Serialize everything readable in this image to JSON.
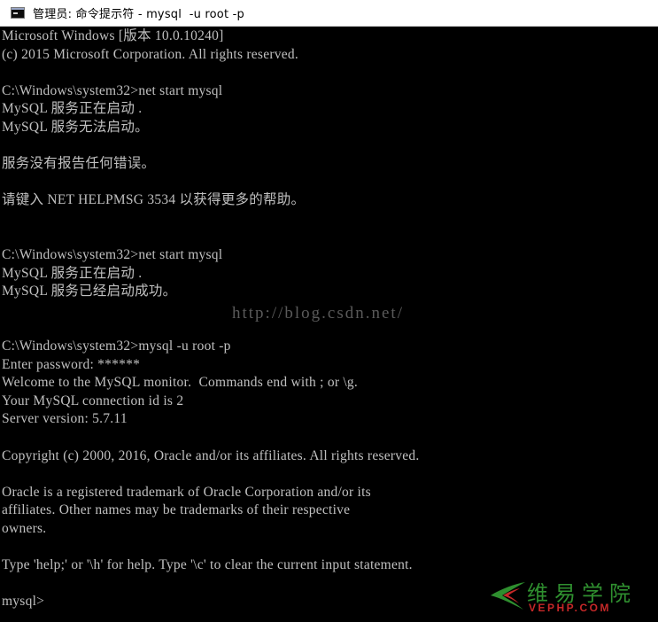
{
  "window": {
    "title": "管理员: 命令提示符 - mysql  -u root -p"
  },
  "console": {
    "lines": [
      "Microsoft Windows [版本 10.0.10240]",
      "(c) 2015 Microsoft Corporation. All rights reserved.",
      "",
      "C:\\Windows\\system32>net start mysql",
      "MySQL 服务正在启动 .",
      "MySQL 服务无法启动。",
      "",
      "服务没有报告任何错误。",
      "",
      "请键入 NET HELPMSG 3534 以获得更多的帮助。",
      "",
      "",
      "C:\\Windows\\system32>net start mysql",
      "MySQL 服务正在启动 .",
      "MySQL 服务已经启动成功。",
      "",
      "",
      "C:\\Windows\\system32>mysql -u root -p",
      "Enter password: ******",
      "Welcome to the MySQL monitor.  Commands end with ; or \\g.",
      "Your MySQL connection id is 2",
      "Server version: 5.7.11",
      "",
      "Copyright (c) 2000, 2016, Oracle and/or its affiliates. All rights reserved.",
      "",
      "Oracle is a registered trademark of Oracle Corporation and/or its",
      "affiliates. Other names may be trademarks of their respective",
      "owners.",
      "",
      "Type 'help;' or '\\h' for help. Type '\\c' to clear the current input statement.",
      "",
      "mysql>"
    ]
  },
  "watermark": {
    "text": "http://blog.csdn.net/"
  },
  "logo": {
    "chinese": "维易学院",
    "english": "VEPHP.COM",
    "green": "#2f8f2f",
    "red": "#c62828"
  },
  "colors": {
    "console_background": "#000000",
    "console_text": "#c0c0c0",
    "titlebar_background": "#ffffff"
  }
}
